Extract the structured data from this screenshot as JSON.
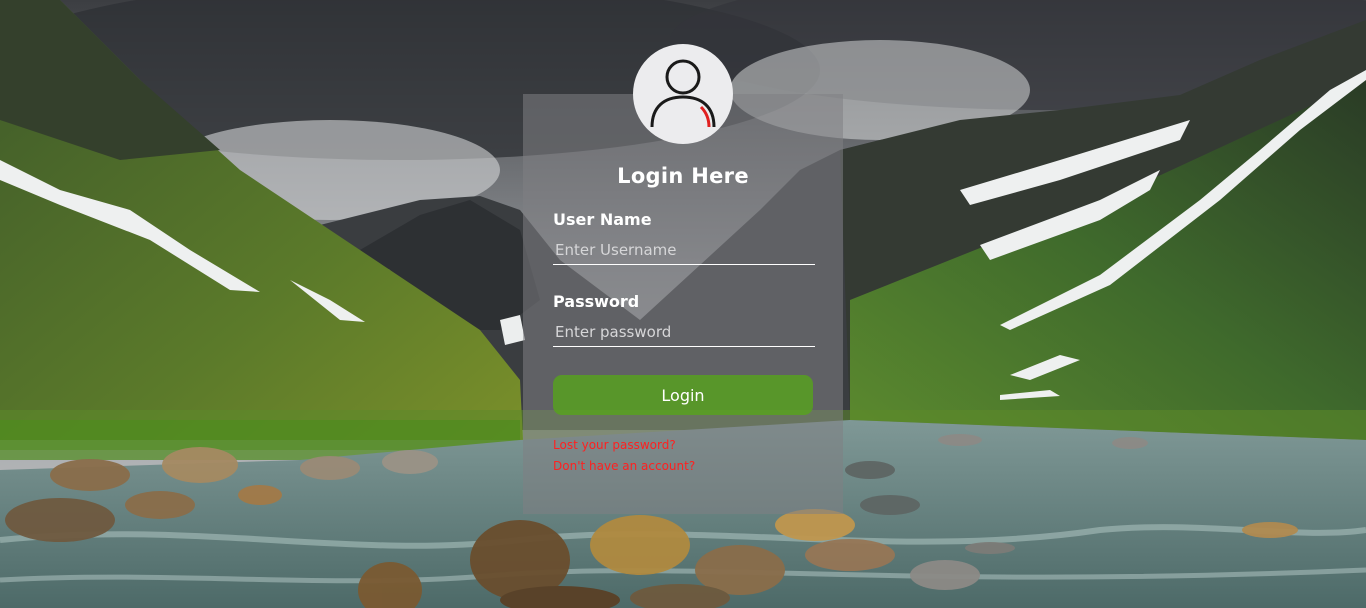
{
  "login": {
    "title": "Login Here",
    "username_label": "User Name",
    "username_placeholder": "Enter Username",
    "username_value": "",
    "password_label": "Password",
    "password_placeholder": "Enter password",
    "password_value": "",
    "submit_label": "Login",
    "lost_password_link": "Lost your password?",
    "signup_link": "Don't have an account?"
  },
  "icons": {
    "avatar": "user-icon"
  },
  "colors": {
    "button": "#54aa14",
    "link": "#ff2020",
    "panel": "#808084"
  }
}
